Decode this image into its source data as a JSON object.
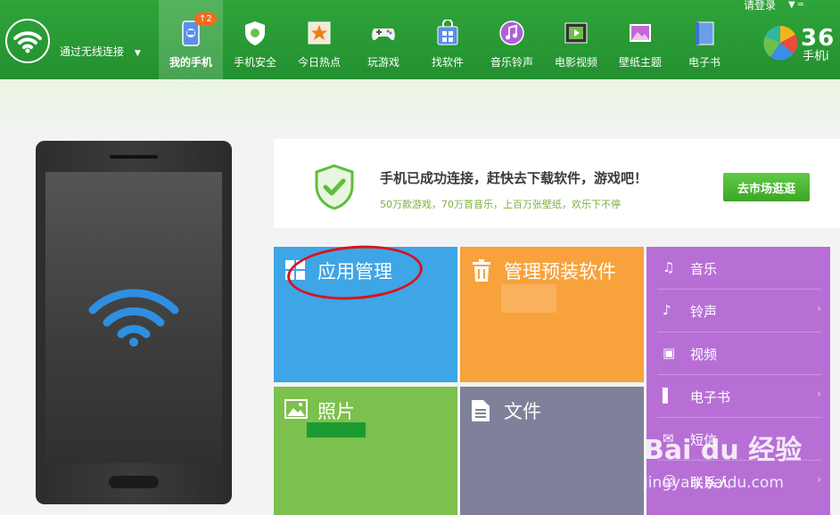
{
  "topbar": {
    "connection_label": "通过无线连接",
    "login_label": "请登录",
    "brand_text": "36",
    "brand_sub": "手机i"
  },
  "nav": [
    {
      "label": "我的手机",
      "icon": "my-phone-icon",
      "badge": "↑2"
    },
    {
      "label": "手机安全",
      "icon": "shield-icon"
    },
    {
      "label": "今日热点",
      "icon": "star-icon"
    },
    {
      "label": "玩游戏",
      "icon": "gamepad-icon"
    },
    {
      "label": "找软件",
      "icon": "software-bag-icon"
    },
    {
      "label": "音乐铃声",
      "icon": "music-icon"
    },
    {
      "label": "电影视频",
      "icon": "film-icon"
    },
    {
      "label": "壁纸主题",
      "icon": "wallpaper-icon"
    },
    {
      "label": "电子书",
      "icon": "ebook-icon"
    }
  ],
  "banner": {
    "title": "手机已成功连接，赶快去下载软件，游戏吧！",
    "subtitle": "50万款游戏，70万首音乐，上百万张壁纸，欢乐下不停",
    "button": "去市场逛逛"
  },
  "tiles": {
    "apps": {
      "label": "应用管理",
      "color": "#3ea5e6"
    },
    "preinstalled": {
      "label": "管理预装软件",
      "color": "#f7a23b"
    },
    "photos": {
      "label": "照片",
      "color": "#7cc04e"
    },
    "files": {
      "label": "文件",
      "color": "#7e8199"
    }
  },
  "media_menu": [
    {
      "label": "音乐",
      "icon": "music-note-icon"
    },
    {
      "label": "铃声",
      "icon": "ringtone-icon"
    },
    {
      "label": "视频",
      "icon": "video-icon"
    },
    {
      "label": "电子书",
      "icon": "book-icon"
    },
    {
      "label": "短信",
      "icon": "sms-icon"
    },
    {
      "label": "联系人",
      "icon": "contacts-icon"
    }
  ],
  "watermark": {
    "main": "Bai du 经验",
    "url": "jingyan.baidu.com"
  },
  "colors": {
    "topbar_green": "#26962f",
    "accent_green": "#3ea526",
    "media_purple": "#b76fd6"
  }
}
